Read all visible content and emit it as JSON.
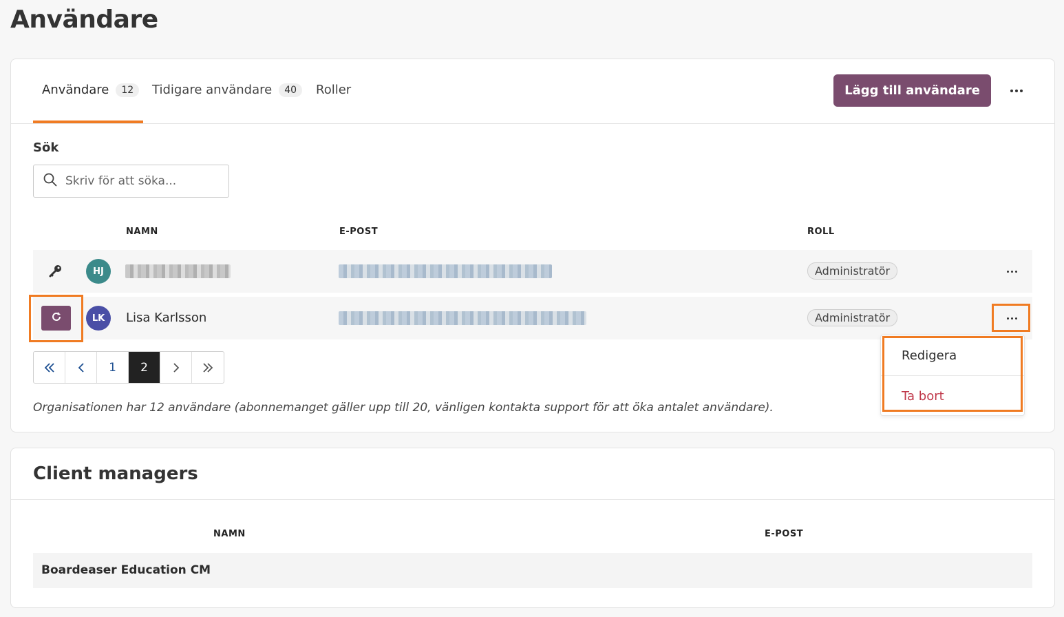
{
  "page": {
    "title": "Användare"
  },
  "tabs": [
    {
      "label": "Användare",
      "count": "12"
    },
    {
      "label": "Tidigare användare",
      "count": "40"
    },
    {
      "label": "Roller"
    }
  ],
  "toolbar": {
    "add_user_label": "Lägg till användare"
  },
  "search": {
    "label": "Sök",
    "placeholder": "Skriv för att söka..."
  },
  "table": {
    "headers": {
      "name": "NAMN",
      "email": "E-POST",
      "role": "ROLL"
    },
    "rows": [
      {
        "initials": "HJ",
        "avatar_color": "#3b8a8a",
        "name": "",
        "email": "",
        "role": "Administratör",
        "status_icon": "key-icon"
      },
      {
        "initials": "LK",
        "avatar_color": "#4a4fa6",
        "name": "Lisa Karlsson",
        "email": "",
        "role": "Administratör",
        "status_icon": "restore-icon"
      }
    ]
  },
  "pagination": {
    "pages": [
      "1",
      "2"
    ],
    "current": "2"
  },
  "note": "Organisationen har 12 användare (abonnemanget gäller upp till 20, vänligen kontakta support för att öka antalet användare).",
  "row_menu": {
    "edit_label": "Redigera",
    "delete_label": "Ta bort"
  },
  "client_managers": {
    "title": "Client managers",
    "headers": {
      "name": "NAMN",
      "email": "E-POST"
    },
    "rows": [
      {
        "name": "Boardeaser Education CM"
      }
    ]
  },
  "colors": {
    "accent": "#7a4c6e",
    "highlight": "#f07b22",
    "danger": "#c0384a",
    "link": "#1d4f91"
  }
}
